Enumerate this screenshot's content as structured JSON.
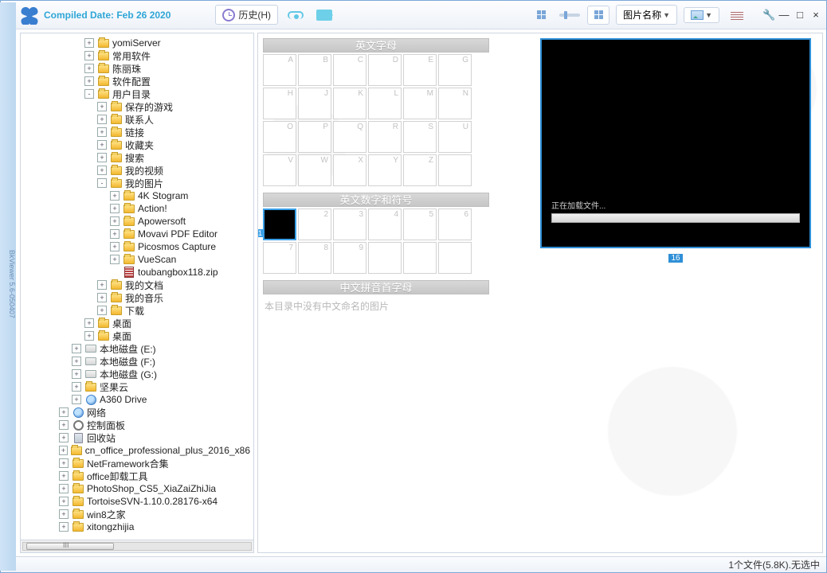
{
  "app": {
    "compiled_date": "Compiled Date: Feb 26 2020",
    "sidebar_text": "BkViewer 5.6-050407"
  },
  "toolbar": {
    "history": "历史(H)",
    "sort_dropdown": "图片名称"
  },
  "win": {
    "wrench": "🔧",
    "min": "—",
    "max": "□",
    "close": "×"
  },
  "tree": [
    {
      "d": 5,
      "e": "+",
      "i": "folder",
      "t": "yomiServer"
    },
    {
      "d": 5,
      "e": "+",
      "i": "folder",
      "t": "常用软件"
    },
    {
      "d": 5,
      "e": "+",
      "i": "folder",
      "t": "陈丽珠"
    },
    {
      "d": 5,
      "e": "+",
      "i": "folder",
      "t": "软件配置"
    },
    {
      "d": 5,
      "e": "-",
      "i": "folder",
      "t": "用户目录"
    },
    {
      "d": 6,
      "e": "+",
      "i": "folder",
      "t": "保存的游戏"
    },
    {
      "d": 6,
      "e": "+",
      "i": "folder",
      "t": "联系人"
    },
    {
      "d": 6,
      "e": "+",
      "i": "folder",
      "t": "链接"
    },
    {
      "d": 6,
      "e": "+",
      "i": "folder",
      "t": "收藏夹"
    },
    {
      "d": 6,
      "e": "+",
      "i": "folder",
      "t": "搜索"
    },
    {
      "d": 6,
      "e": "+",
      "i": "folder",
      "t": "我的视频"
    },
    {
      "d": 6,
      "e": "-",
      "i": "folder",
      "t": "我的图片"
    },
    {
      "d": 7,
      "e": "+",
      "i": "folder",
      "t": "4K Stogram"
    },
    {
      "d": 7,
      "e": "+",
      "i": "folder",
      "t": "Action!"
    },
    {
      "d": 7,
      "e": "+",
      "i": "folder",
      "t": "Apowersoft"
    },
    {
      "d": 7,
      "e": "+",
      "i": "folder",
      "t": "Movavi PDF Editor"
    },
    {
      "d": 7,
      "e": "+",
      "i": "folder",
      "t": "Picosmos Capture"
    },
    {
      "d": 7,
      "e": "+",
      "i": "folder",
      "t": "VueScan"
    },
    {
      "d": 7,
      "e": "",
      "i": "zip",
      "t": "toubangbox118.zip"
    },
    {
      "d": 6,
      "e": "+",
      "i": "folder",
      "t": "我的文档"
    },
    {
      "d": 6,
      "e": "+",
      "i": "folder",
      "t": "我的音乐"
    },
    {
      "d": 6,
      "e": "+",
      "i": "folder",
      "t": "下载"
    },
    {
      "d": 5,
      "e": "+",
      "i": "folder",
      "t": "桌面"
    },
    {
      "d": 5,
      "e": "+",
      "i": "folder",
      "t": "桌面"
    },
    {
      "d": 4,
      "e": "+",
      "i": "drive",
      "t": "本地磁盘 (E:)"
    },
    {
      "d": 4,
      "e": "+",
      "i": "drive",
      "t": "本地磁盘 (F:)"
    },
    {
      "d": 4,
      "e": "+",
      "i": "drive",
      "t": "本地磁盘 (G:)"
    },
    {
      "d": 4,
      "e": "+",
      "i": "folder",
      "t": "坚果云"
    },
    {
      "d": 4,
      "e": "+",
      "i": "globe",
      "t": "A360 Drive"
    },
    {
      "d": 3,
      "e": "+",
      "i": "globe",
      "t": "网络"
    },
    {
      "d": 3,
      "e": "+",
      "i": "gear",
      "t": "控制面板"
    },
    {
      "d": 3,
      "e": "+",
      "i": "bin",
      "t": "回收站"
    },
    {
      "d": 3,
      "e": "+",
      "i": "folder",
      "t": "cn_office_professional_plus_2016_x86"
    },
    {
      "d": 3,
      "e": "+",
      "i": "folder",
      "t": "NetFramework合集"
    },
    {
      "d": 3,
      "e": "+",
      "i": "folder",
      "t": "office卸载工具"
    },
    {
      "d": 3,
      "e": "+",
      "i": "folder",
      "t": "PhotoShop_CS5_XiaZaiZhiJia"
    },
    {
      "d": 3,
      "e": "+",
      "i": "folder",
      "t": "TortoiseSVN-1.10.0.28176-x64"
    },
    {
      "d": 3,
      "e": "+",
      "i": "folder",
      "t": "win8之家"
    },
    {
      "d": 3,
      "e": "+",
      "i": "folder",
      "t": "xitongzhijia"
    }
  ],
  "scroll_marker": "III",
  "sections": {
    "alpha_header": "英文字母",
    "alpha_letters": [
      "A",
      "B",
      "C",
      "D",
      "E",
      "G",
      "H",
      "J",
      "K",
      "L",
      "M",
      "N",
      "O",
      "P",
      "Q",
      "R",
      "S",
      "U",
      "V",
      "W",
      "X",
      "Y",
      "Z",
      ""
    ],
    "numsym_header": "英文数字和符号",
    "numsym_cells": [
      "1",
      "2",
      "3",
      "4",
      "5",
      "6",
      "7",
      "8",
      "9",
      "",
      "",
      ""
    ],
    "pinyin_header": "中文拼音首字母",
    "pinyin_note": "本目录中没有中文命名的图片"
  },
  "preview": {
    "loading": "正在加载文件...",
    "label": "16"
  },
  "statusbar": "1个文件(5.8K).无选中"
}
